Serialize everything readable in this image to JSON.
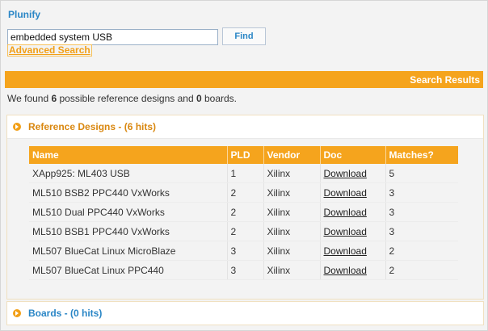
{
  "header": {
    "brand": "Plunify"
  },
  "search": {
    "query": "embedded system USB",
    "find_label": "Find",
    "advanced_label": "Advanced Search"
  },
  "results_bar": {
    "title": "Search Results"
  },
  "summary": {
    "prefix": "We found ",
    "designs": "6",
    "middle": " possible reference designs and ",
    "boards": "0",
    "suffix": " boards."
  },
  "reference_panel": {
    "title": "Reference Designs - (6 hits)",
    "columns": [
      "Name",
      "PLD",
      "Vendor",
      "Doc",
      "Matches?"
    ],
    "rows": [
      {
        "name": "XApp925: ML403 USB",
        "pld": "1",
        "vendor": "Xilinx",
        "doc": "Download",
        "matches": "5"
      },
      {
        "name": "ML510 BSB2 PPC440 VxWorks",
        "pld": "2",
        "vendor": "Xilinx",
        "doc": "Download",
        "matches": "3"
      },
      {
        "name": "ML510 Dual PPC440 VxWorks",
        "pld": "2",
        "vendor": "Xilinx",
        "doc": "Download",
        "matches": "3"
      },
      {
        "name": "ML510 BSB1 PPC440 VxWorks",
        "pld": "2",
        "vendor": "Xilinx",
        "doc": "Download",
        "matches": "3"
      },
      {
        "name": "ML507 BlueCat Linux MicroBlaze",
        "pld": "3",
        "vendor": "Xilinx",
        "doc": "Download",
        "matches": "2"
      },
      {
        "name": "ML507 BlueCat Linux PPC440",
        "pld": "3",
        "vendor": "Xilinx",
        "doc": "Download",
        "matches": "2"
      }
    ]
  },
  "boards_panel": {
    "title": "Boards - (0 hits)"
  },
  "colors": {
    "accent": "#f5a41d",
    "link_blue": "#2a86c6",
    "panel_title": "#d9870f"
  },
  "icons": {
    "expand": "chevron-circle-icon"
  }
}
